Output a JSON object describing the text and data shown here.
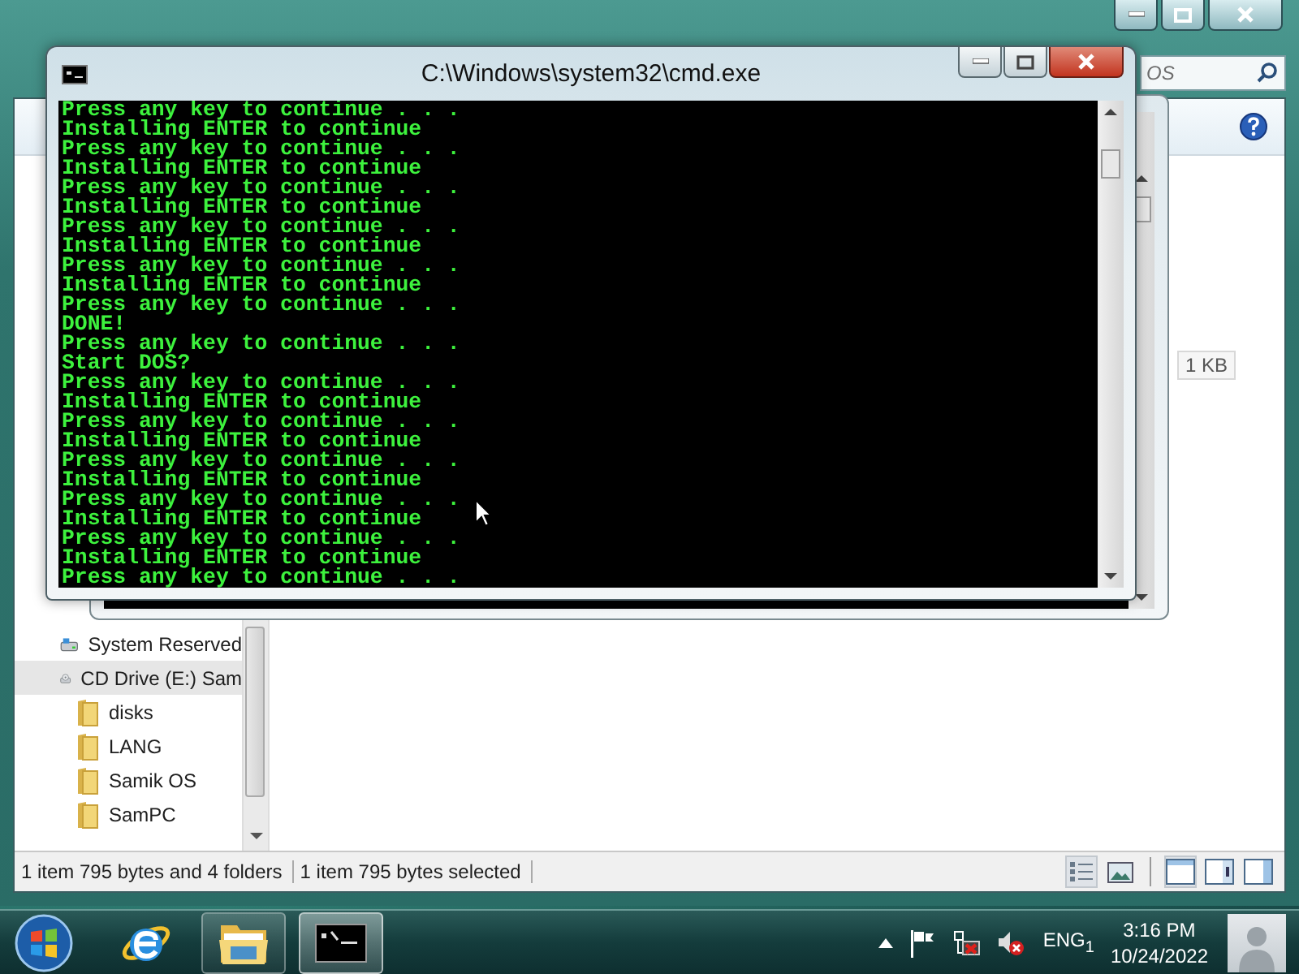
{
  "explorer": {
    "search": {
      "placeholder": "OS"
    },
    "nav_items": [
      {
        "label": "System Reserved",
        "kind": "drive",
        "selected": false
      },
      {
        "label": "CD Drive (E:) Sam",
        "kind": "cd",
        "selected": true
      },
      {
        "label": "disks",
        "kind": "folder",
        "selected": false
      },
      {
        "label": "LANG",
        "kind": "folder",
        "selected": false
      },
      {
        "label": "Samik OS",
        "kind": "folder",
        "selected": false
      },
      {
        "label": "SamPC",
        "kind": "folder",
        "selected": false
      }
    ],
    "size_cell": "1 KB",
    "status_bar": [
      "1 item 795 bytes and 4 folders",
      "1 item 795 bytes selected"
    ]
  },
  "cmd": {
    "title": "C:\\Windows\\system32\\cmd.exe",
    "lines": [
      "Press any key to continue . . .",
      "Installing ENTER to continue",
      "Press any key to continue . . .",
      "Installing ENTER to continue",
      "Press any key to continue . . .",
      "Installing ENTER to continue",
      "Press any key to continue . . .",
      "Installing ENTER to continue",
      "Press any key to continue . . .",
      "Installing ENTER to continue",
      "Press any key to continue . . .",
      "DONE!",
      "Press any key to continue . . .",
      "Start DOS?",
      "Press any key to continue . . .",
      "Installing ENTER to continue",
      "Press any key to continue . . .",
      "Installing ENTER to continue",
      "Press any key to continue . . .",
      "Installing ENTER to continue",
      "Press any key to continue . . .",
      "Installing ENTER to continue",
      "Press any key to continue . . .",
      "Installing ENTER to continue",
      "Press any key to continue . . ."
    ]
  },
  "taskbar": {
    "apps": [
      {
        "kind": "ie",
        "open": false,
        "active": false
      },
      {
        "kind": "explorer",
        "open": true,
        "active": false
      },
      {
        "kind": "cmd",
        "open": true,
        "active": true
      }
    ],
    "language": "ENG$_{1}$",
    "time": "3:16 PM",
    "date": "10/24/2022"
  }
}
